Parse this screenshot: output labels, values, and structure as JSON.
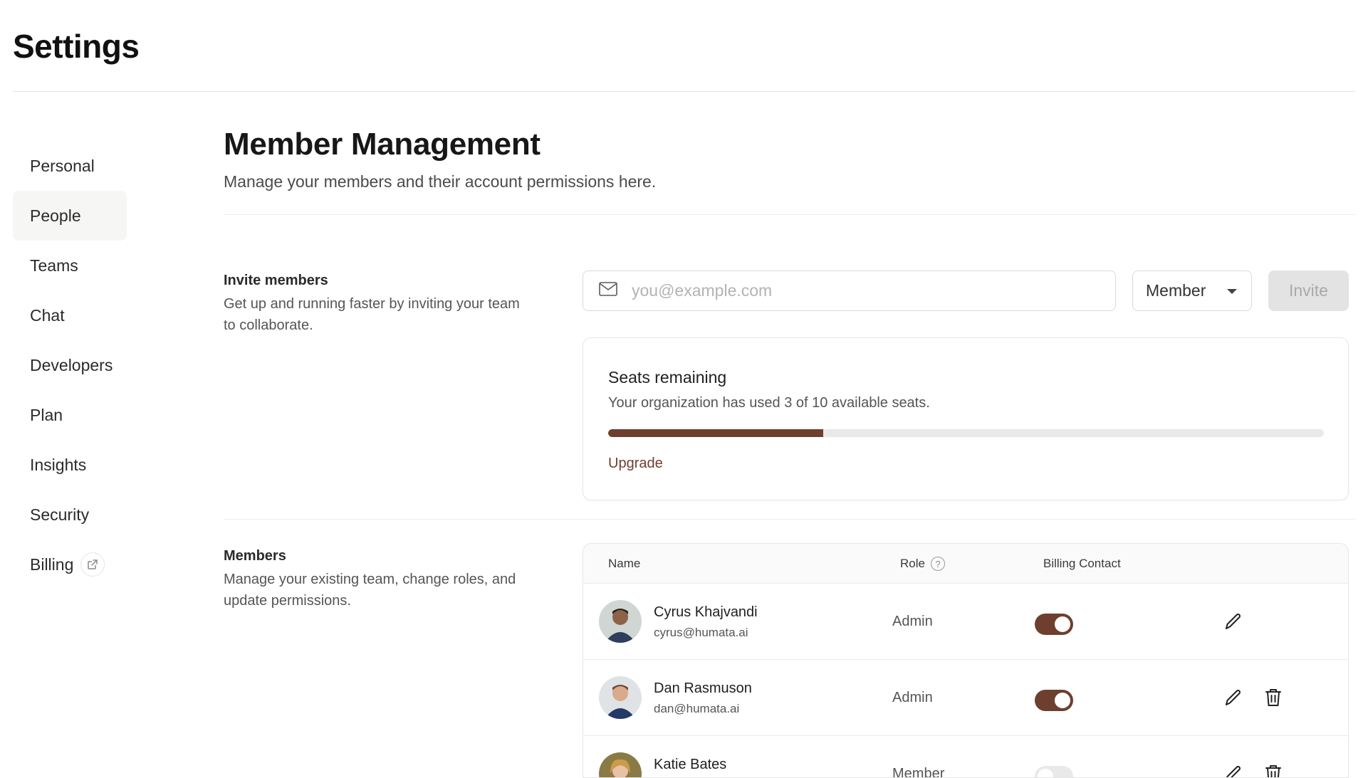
{
  "page": {
    "title": "Settings"
  },
  "sidebar": {
    "items": [
      {
        "label": "Personal",
        "active": false
      },
      {
        "label": "People",
        "active": true
      },
      {
        "label": "Teams",
        "active": false
      },
      {
        "label": "Chat",
        "active": false
      },
      {
        "label": "Developers",
        "active": false
      },
      {
        "label": "Plan",
        "active": false
      },
      {
        "label": "Insights",
        "active": false
      },
      {
        "label": "Security",
        "active": false
      },
      {
        "label": "Billing",
        "active": false,
        "icon": "external-link-icon"
      }
    ]
  },
  "main": {
    "title": "Member Management",
    "subtitle": "Manage your members and their account permissions here."
  },
  "invite": {
    "heading": "Invite members",
    "description": "Get up and running faster by inviting your team to collaborate.",
    "email_placeholder": "you@example.com",
    "email_value": "",
    "email_icon": "mail-icon",
    "role_selected": "Member",
    "button_label": "Invite"
  },
  "seats": {
    "title": "Seats remaining",
    "description": "Your organization has used 3 of 10 available seats.",
    "used": 3,
    "total": 10,
    "progress_fraction": 0.3,
    "upgrade_label": "Upgrade"
  },
  "members": {
    "heading": "Members",
    "description": "Manage your existing team, change roles, and update permissions.",
    "columns": {
      "name": "Name",
      "role": "Role",
      "billing": "Billing Contact"
    },
    "rows": [
      {
        "name": "Cyrus Khajvandi",
        "email": "cyrus@humata.ai",
        "role": "Admin",
        "billing_contact": true,
        "can_delete": false
      },
      {
        "name": "Dan Rasmuson",
        "email": "dan@humata.ai",
        "role": "Admin",
        "billing_contact": true,
        "can_delete": true
      },
      {
        "name": "Katie Bates",
        "email": "",
        "role": "Member",
        "billing_contact": false,
        "can_delete": true
      }
    ]
  },
  "colors": {
    "accent": "#6e3f2e",
    "track": "#e9e9e9",
    "sidebar_active_bg": "#f6f6f5",
    "disabled_button_bg": "#e3e3e3"
  }
}
